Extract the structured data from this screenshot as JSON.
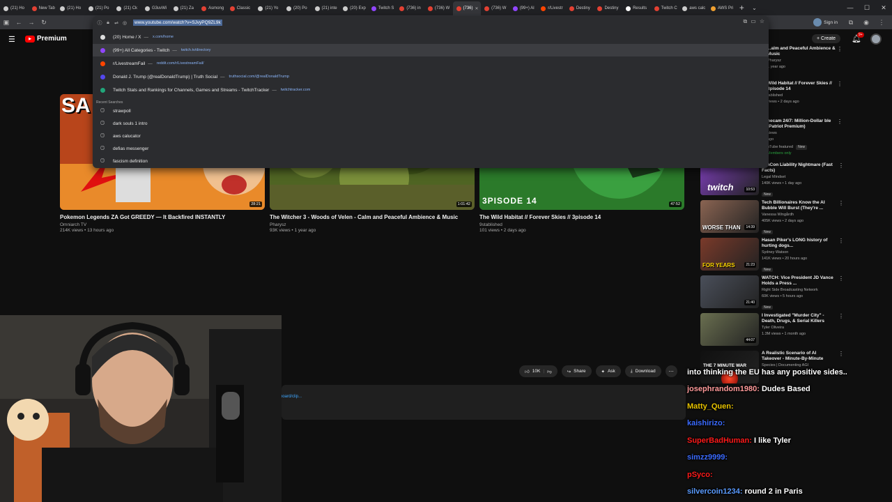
{
  "tabs": [
    {
      "label": "(21) Ho",
      "fav": "#cccccc",
      "icon": "x-icon"
    },
    {
      "label": "New Tab",
      "fav": "#e34133",
      "icon": "youtube-icon"
    },
    {
      "label": "(21) Ho",
      "fav": "#cccccc",
      "icon": "x-icon"
    },
    {
      "label": "(21) Po",
      "fav": "#cccccc",
      "icon": "x-icon"
    },
    {
      "label": "(21) Ck",
      "fav": "#cccccc",
      "icon": "x-icon"
    },
    {
      "label": "G3uvWi",
      "fav": "#cccccc",
      "icon": "x-icon"
    },
    {
      "label": "(21) Za",
      "fav": "#cccccc",
      "icon": "x-icon"
    },
    {
      "label": "Asmong",
      "fav": "#e34133",
      "icon": "youtube-icon"
    },
    {
      "label": "Classic",
      "fav": "#e34133",
      "icon": "youtube-icon"
    },
    {
      "label": "(21) Yo",
      "fav": "#cccccc",
      "icon": "x-icon"
    },
    {
      "label": "(20) Po",
      "fav": "#cccccc",
      "icon": "x-icon"
    },
    {
      "label": "(21) inte",
      "fav": "#cccccc",
      "icon": "x-icon"
    },
    {
      "label": "(20) Exp",
      "fav": "#cccccc",
      "icon": "x-icon"
    },
    {
      "label": "Twitch S",
      "fav": "#9146ff",
      "icon": "twitch-icon"
    },
    {
      "label": "(736) in",
      "fav": "#e34133",
      "icon": "youtube-icon"
    },
    {
      "label": "(736) W",
      "fav": "#e34133",
      "icon": "youtube-icon"
    },
    {
      "label": "(736)",
      "fav": "#e34133",
      "icon": "youtube-icon",
      "active": true
    },
    {
      "label": "(736) W",
      "fav": "#e34133",
      "icon": "youtube-icon"
    },
    {
      "label": "(99+) Al",
      "fav": "#9146ff",
      "icon": "twitch-icon"
    },
    {
      "label": "r/Livestr",
      "fav": "#ff4500",
      "icon": "reddit-icon"
    },
    {
      "label": "Destiny",
      "fav": "#e34133",
      "icon": "youtube-icon"
    },
    {
      "label": "Destiny",
      "fav": "#e34133",
      "icon": "youtube-icon"
    },
    {
      "label": "Results",
      "fav": "#ffffff",
      "icon": "search-icon"
    },
    {
      "label": "Twitch C",
      "fav": "#e34133",
      "icon": "youtube-icon"
    },
    {
      "label": "aws calc",
      "fav": "#cccccc",
      "icon": "google-icon"
    },
    {
      "label": "AWS Pri",
      "fav": "#f0a030",
      "icon": "aws-icon"
    }
  ],
  "toolbar": {
    "signin": "Sign in"
  },
  "omnibox": {
    "url": "www.youtube.com/watch?v=SJvyPQ9ZL9k",
    "suggestions": [
      {
        "title": "(20) Home / X",
        "url": "x.com/home",
        "fav": "#dddddd",
        "hover": false
      },
      {
        "title": "(99+) All Categories - Twitch",
        "url": "twitch.tv/directory",
        "fav": "#9146ff",
        "hover": true
      },
      {
        "title": "r/LivestreamFail",
        "url": "reddit.com/r/LivestreamFail/",
        "fav": "#ff4500",
        "hover": false
      },
      {
        "title": "Donald J. Trump (@realDonaldTrump) | Truth Social",
        "url": "truthsocial.com/@realDonaldTrump",
        "fav": "#5448ee",
        "hover": false
      },
      {
        "title": "Twitch Stats and Rankings for Channels, Games and Streams - TwitchTracker",
        "url": "twitchtracker.com",
        "fav": "#21a67a",
        "hover": false
      }
    ],
    "recent_label": "Recent Searches",
    "recent": [
      "strawpoll",
      "dark souls 1 intro",
      "aws calucator",
      "defias messenger",
      "fascism definition"
    ]
  },
  "yt": {
    "logo": "Premium",
    "create": "Create",
    "notif_count": "9+"
  },
  "videos": [
    {
      "title": "Pokemon Legends ZA Got GREEDY — It Backfired INSTANTLY",
      "channel": "Omniarch TV",
      "meta": "214K views • 13 hours ago",
      "duration": "28:21",
      "thumb_text": "SA",
      "bg": "#c8461e"
    },
    {
      "title": "The Witcher 3 - Woods of Velen - Calm and Peaceful Ambience & Music",
      "channel": "Pharysz",
      "meta": "93K views • 1 year ago",
      "duration": "1:01:42",
      "bg": "#566b2a"
    },
    {
      "title": "The Wild Habitat // Forever Skies // 3pisode 14",
      "channel": "9stablished",
      "meta": "101 views • 2 days ago",
      "duration": "47:52",
      "thumb_text": "3PISODE 14",
      "bg": "#2f7a2c"
    }
  ],
  "sidebar_top": [
    {
      "title": "...alm and Peaceful Ambience & Music",
      "line1": "Pharysz",
      "line2": "1 year ago"
    },
    {
      "title": "Wild Habitat // Forever Skies // 3pisode 14",
      "line1": "tablished",
      "line2": "views • 2 days ago"
    },
    {
      "title": "necam 24/7: Million-Dollar ble (Patriot Premium)",
      "line1": "News",
      "line2": "ago",
      "line3": "uTube featured",
      "badge": "New",
      "line4": "Members only"
    }
  ],
  "sidebar": [
    {
      "title": "itchCon Liability Nightmare (Fast Facts)",
      "channel": "Legal Mindset",
      "meta": "140K views • 1 day ago",
      "badge": "New",
      "duration": "10:53",
      "overlay": "twitch",
      "bg": "#7d3fb8"
    },
    {
      "title": "Tech Billionaires Know the AI Bubble Will Burst (They're ...",
      "channel": "Vanessa Wingårdh",
      "meta": "405K views • 2 days ago",
      "badge": "New",
      "duration": "14:39",
      "overlay": "WORSE THAN",
      "bg": "#8a6452"
    },
    {
      "title": "Hasan Piker's LONG history of hurting dogs...",
      "channel": "Sydney Watson",
      "meta": "141K views • 20 hours ago",
      "badge": "New",
      "duration": "21:23",
      "overlay": "FOR YEARS",
      "bg": "#7a3a2a"
    },
    {
      "title": "WATCH: Vice President JD Vance Holds a Press ...",
      "channel": "Right Side Broadcasting Network",
      "meta": "60K views • 5 hours ago",
      "badge": "New",
      "duration": "21:40",
      "overlay": "",
      "bg": "#4a4f5a"
    },
    {
      "title": "I Investigated \"Murder City\" - Death, Drugs, & Serial Killers",
      "channel": "Tyler Oliveira",
      "meta": "1.3M views • 1 month ago",
      "badge": "",
      "duration": "44:07",
      "overlay": "",
      "bg": "#6a6f50"
    },
    {
      "title": "A Realistic Scenario of AI Takeover - Minute-By-Minute",
      "channel": "Species | Documenting AGI",
      "meta": "",
      "badge": "",
      "duration": "",
      "overlay": "THE 7 MINUTE WAR",
      "bg": "#101010"
    }
  ],
  "actions": {
    "likes": "10K",
    "share": "Share",
    "ask": "Ask",
    "download": "Download"
  },
  "desc_link": "board/clip...",
  "chat": [
    {
      "user": "",
      "user_color": "#ffffff",
      "text": "into thinking the EU has any positive sides.."
    },
    {
      "user": "josephrandom1980:",
      "user_color": "#ff9a9a",
      "text": "Dudes Based"
    },
    {
      "user": "Matty_Quen:",
      "user_color": "#e6c200",
      "text": ""
    },
    {
      "user": "kaishirizo:",
      "user_color": "#3b6bff",
      "text": ""
    },
    {
      "user": "SuperBadHuman:",
      "user_color": "#ff1a1a",
      "text": "I like Tyler"
    },
    {
      "user": "simzz9999:",
      "user_color": "#3b6bff",
      "text": ""
    },
    {
      "user": "pSyco:",
      "user_color": "#ff1a1a",
      "text": ""
    },
    {
      "user": "silvercoin1234:",
      "user_color": "#5a9bff",
      "text": "round 2 in Paris"
    }
  ]
}
